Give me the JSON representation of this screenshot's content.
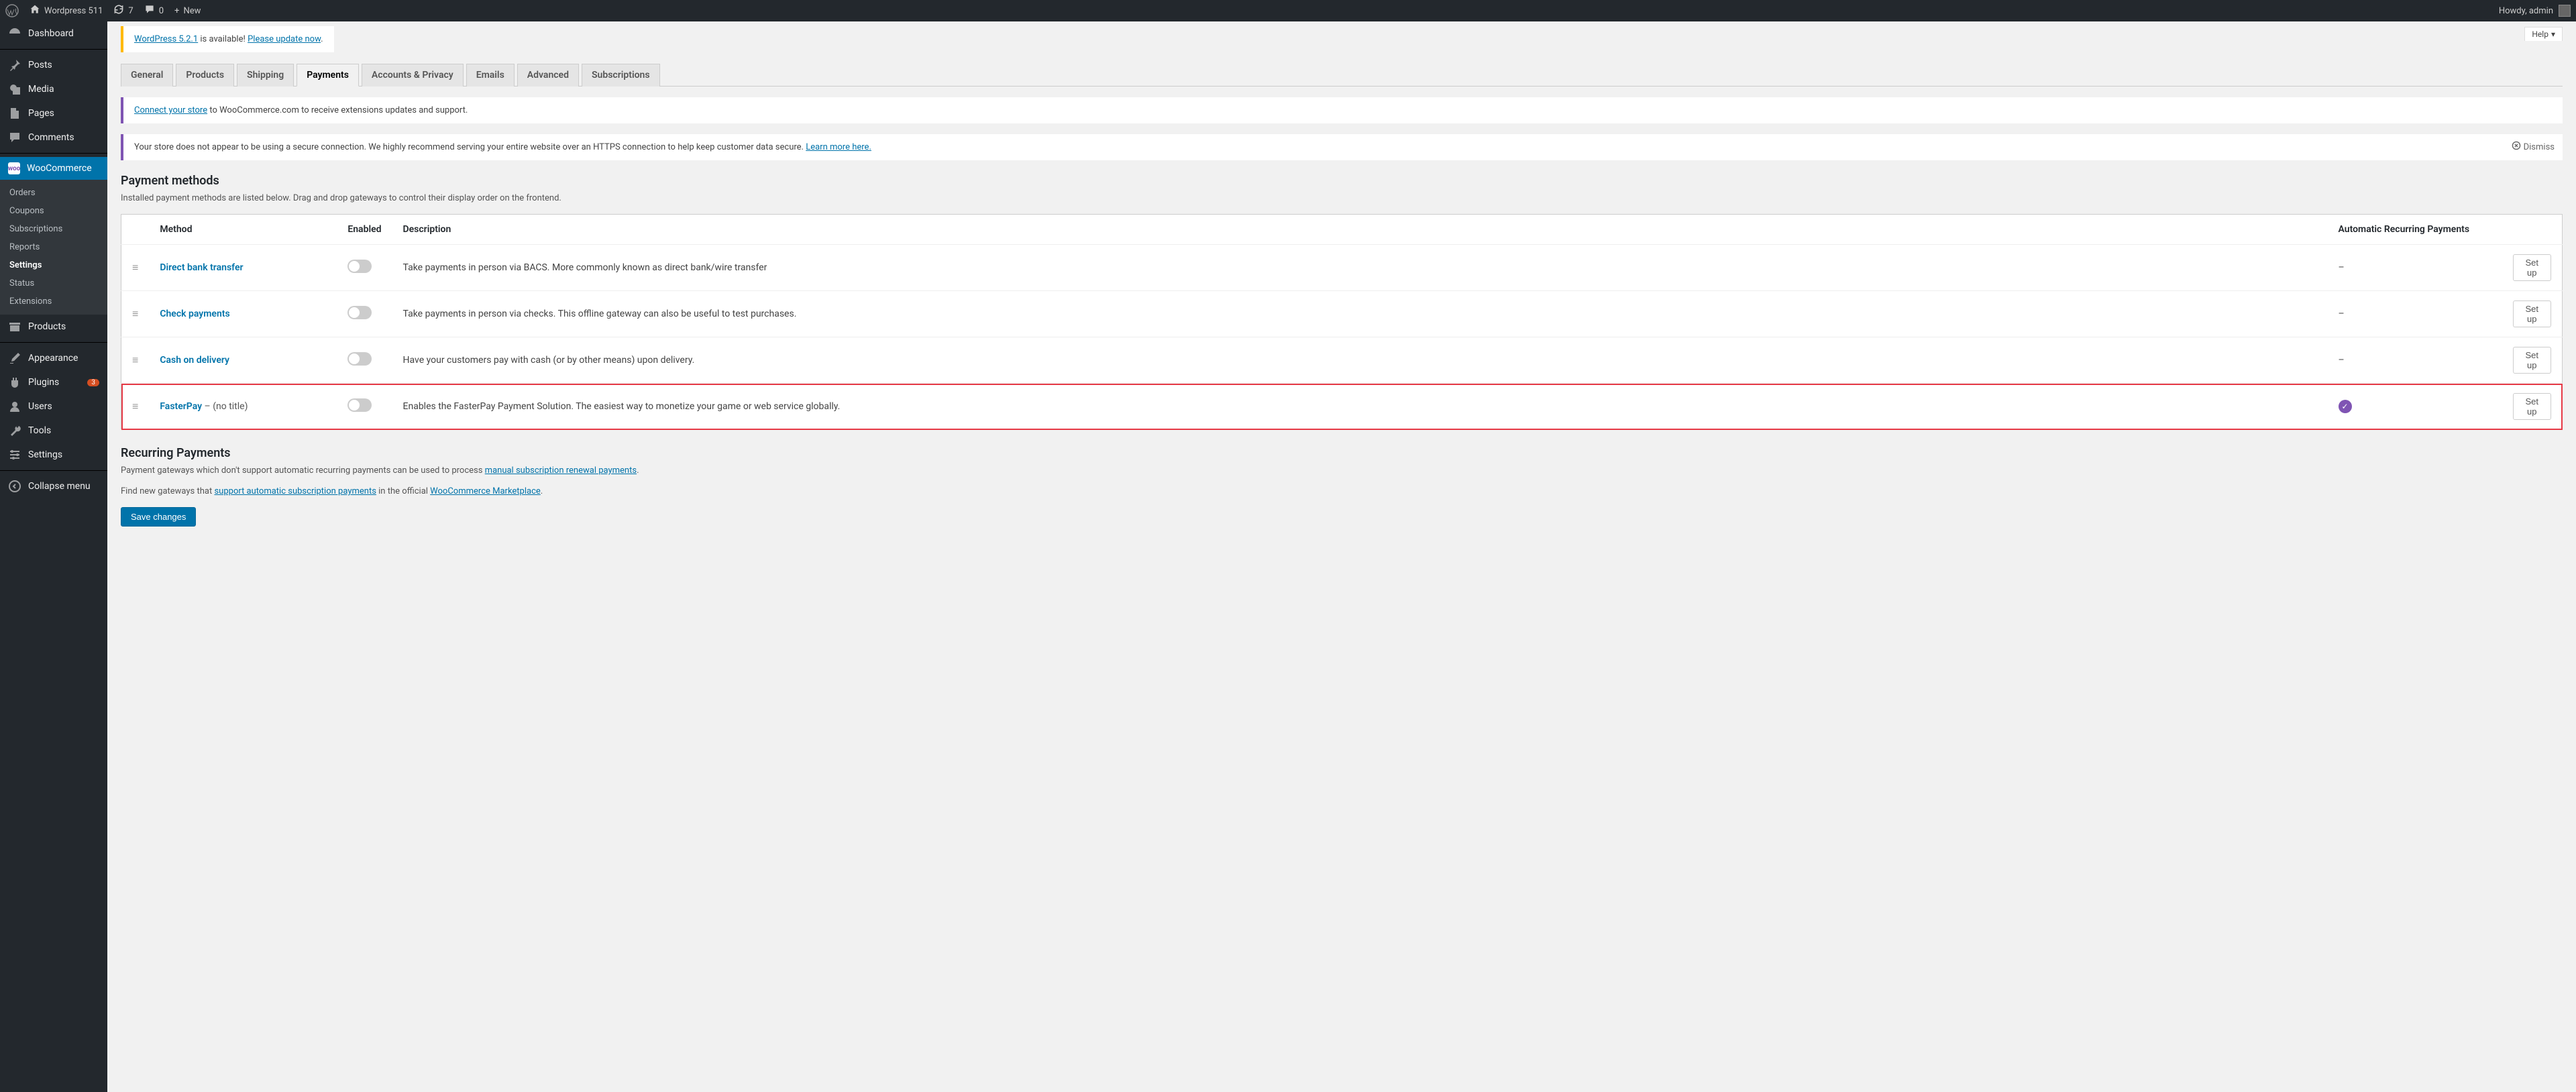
{
  "adminBar": {
    "siteName": "Wordpress 511",
    "updates": "7",
    "comments": "0",
    "new": "New",
    "howdy": "Howdy, admin"
  },
  "sidebar": {
    "dashboard": "Dashboard",
    "posts": "Posts",
    "media": "Media",
    "pages": "Pages",
    "comments": "Comments",
    "woocommerce": "WooCommerce",
    "wooSub": {
      "orders": "Orders",
      "coupons": "Coupons",
      "subscriptions": "Subscriptions",
      "reports": "Reports",
      "settings": "Settings",
      "status": "Status",
      "extensions": "Extensions"
    },
    "products": "Products",
    "appearance": "Appearance",
    "plugins": "Plugins",
    "pluginCount": "3",
    "users": "Users",
    "tools": "Tools",
    "settings": "Settings",
    "collapse": "Collapse menu"
  },
  "helpTab": "Help",
  "notices": {
    "update1": "WordPress 5.2.1",
    "update2": " is available! ",
    "update3": "Please update now",
    "connect1": "Connect your store",
    "connect2": " to WooCommerce.com to receive extensions updates and support.",
    "secure1": "Your store does not appear to be using a secure connection. We highly recommend serving your entire website over an HTTPS connection to help keep customer data secure. ",
    "secure2": "Learn more here.",
    "dismiss": "Dismiss"
  },
  "tabs": {
    "general": "General",
    "products": "Products",
    "shipping": "Shipping",
    "payments": "Payments",
    "accounts": "Accounts & Privacy",
    "emails": "Emails",
    "advanced": "Advanced",
    "subscriptions": "Subscriptions"
  },
  "paymentMethods": {
    "heading": "Payment methods",
    "intro": "Installed payment methods are listed below. Drag and drop gateways to control their display order on the frontend.",
    "columns": {
      "method": "Method",
      "enabled": "Enabled",
      "description": "Description",
      "recurring": "Automatic Recurring Payments"
    },
    "rows": [
      {
        "name": "Direct bank transfer",
        "suffix": "",
        "enabled": false,
        "description": "Take payments in person via BACS. More commonly known as direct bank/wire transfer",
        "recurring": "–",
        "action": "Set up",
        "highlight": false
      },
      {
        "name": "Check payments",
        "suffix": "",
        "enabled": false,
        "description": "Take payments in person via checks. This offline gateway can also be useful to test purchases.",
        "recurring": "–",
        "action": "Set up",
        "highlight": false
      },
      {
        "name": "Cash on delivery",
        "suffix": "",
        "enabled": false,
        "description": "Have your customers pay with cash (or by other means) upon delivery.",
        "recurring": "–",
        "action": "Set up",
        "highlight": false
      },
      {
        "name": "FasterPay",
        "suffix": " – (no title)",
        "enabled": false,
        "description": "Enables the FasterPay Payment Solution. The easiest way to monetize your game or web service globally.",
        "recurring": "check",
        "action": "Set up",
        "highlight": true
      }
    ]
  },
  "recurring": {
    "heading": "Recurring Payments",
    "p1a": "Payment gateways which don't support automatic recurring payments can be used to process ",
    "p1b": "manual subscription renewal payments",
    "p1c": ".",
    "p2a": "Find new gateways that ",
    "p2b": "support automatic subscription payments",
    "p2c": " in the official ",
    "p2d": "WooCommerce Marketplace",
    "p2e": "."
  },
  "saveButton": "Save changes"
}
